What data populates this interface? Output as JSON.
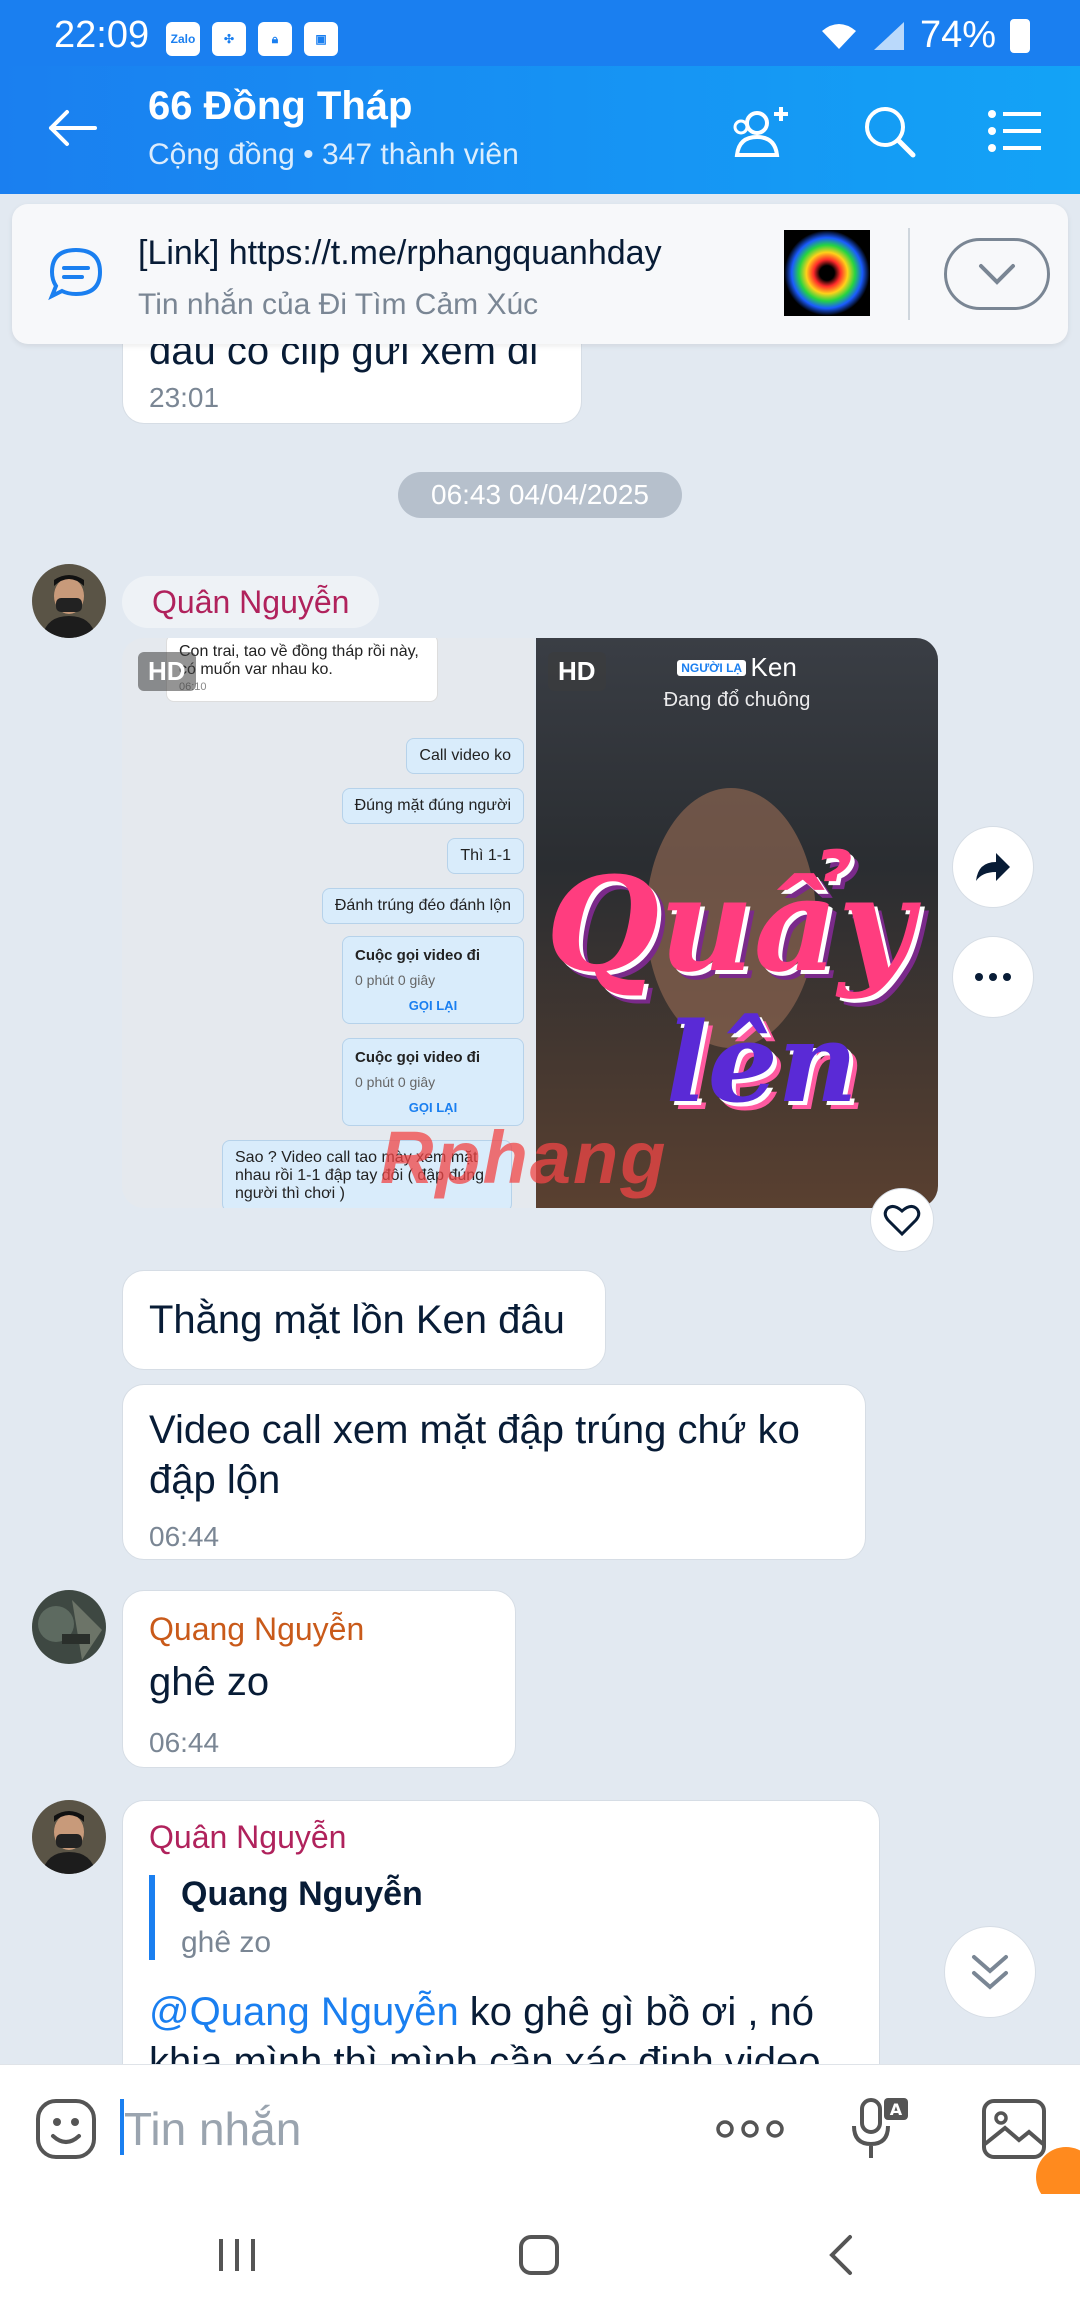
{
  "status": {
    "time": "22:09",
    "battery": "74%",
    "left_icons": [
      "Zalo",
      "pinwheel-icon",
      "lock-icon",
      "gallery-icon"
    ]
  },
  "header": {
    "title": "66 Đồng Tháp",
    "subtitle": "Cộng đồng • 347 thành viên",
    "icons": [
      "back-arrow-icon",
      "add-member-icon",
      "search-icon",
      "list-menu-icon"
    ]
  },
  "pinned": {
    "title": "[Link] https://t.me/rphangquanhday",
    "subtitle": "Tin nhắn của Đi Tìm Cảm Xúc"
  },
  "messages": {
    "prev": {
      "text_partial": "đâu có clip gửi xem đi",
      "time": "23:01"
    },
    "date_divider": "06:43 04/04/2025",
    "m1": {
      "sender": "Quân Nguyễn",
      "sender_color": "#b0225c"
    },
    "media": {
      "badge": "HD",
      "left_lines": {
        "top": "Con trai, tao về đồng tháp rồi này, có muốn var nhau ko.",
        "top_time": "06:10",
        "b1": "Call video ko",
        "b2": "Đúng mặt đúng người",
        "b3": "Thì 1-1",
        "b4": "Đánh trúng đéo đánh lộn",
        "call1_title": "Cuộc gọi video đi",
        "call1_sub": "0 phút 0 giây",
        "call1_link": "GỌI LẠI",
        "call2_title": "Cuộc gọi video đi",
        "call2_sub": "0 phút 0 giây",
        "call2_link": "GỌI LẠI",
        "bottom": "Sao ? Video call tao mày xem mặt nhau rồi 1-1 đập tay đôi ( đập đúng người thì chơi )"
      },
      "right": {
        "caller_tag": "NGƯỜI LẠ",
        "caller": "Ken",
        "status": "Đang đổ chuông",
        "sticker_line1": "Quẩy",
        "sticker_line2": "lên"
      },
      "watermark": "Rphang"
    },
    "m2": {
      "text": "Thằng mặt lồn Ken đâu"
    },
    "m3": {
      "text": "Video call xem mặt đập trúng chứ ko đập lộn",
      "time": "06:44"
    },
    "m4": {
      "sender": "Quang Nguyễn",
      "sender_color": "#c95a1a",
      "text": "ghê zo",
      "time": "06:44"
    },
    "m5": {
      "sender": "Quân Nguyễn",
      "quote_name": "Quang Nguyễn",
      "quote_text": "ghê zo",
      "mention": "@Quang Nguyễn",
      "text": " ko ghê gì bồ ơi , nó",
      "text2": "khịa mình thì mình cần xác định video"
    }
  },
  "input": {
    "placeholder": "Tin nhắn"
  },
  "colors": {
    "accent": "#1a7ff0",
    "background": "#e2e9f1"
  }
}
